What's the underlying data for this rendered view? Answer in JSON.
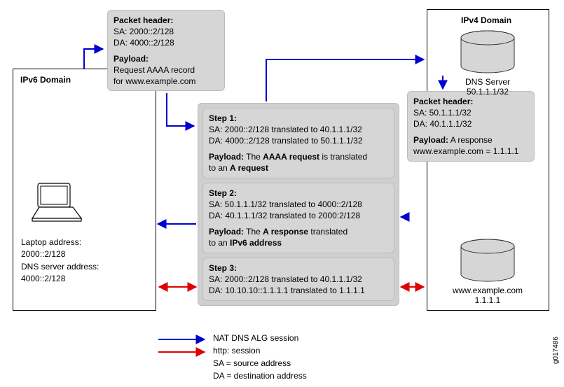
{
  "domains": {
    "ipv6_title": "IPv6 Domain",
    "ipv4_title": "IPv4 Domain"
  },
  "packet_left": {
    "hdr_label": "Packet header:",
    "sa": "SA: 2000::2/128",
    "da": "DA: 4000::2/128",
    "pl_label": "Payload:",
    "pl_line1": "Request AAAA record",
    "pl_line2": "for www.example.com"
  },
  "packet_right": {
    "hdr_label": "Packet header:",
    "sa": "SA: 50.1.1.1/32",
    "da": "DA: 40.1.1.1/32",
    "pl_label": "Payload:",
    "pl_line1": "A response",
    "pl_line2": "www.example.com = 1.1.1.1"
  },
  "step1": {
    "title": "Step 1:",
    "sa": "SA: 2000::2/128 translated to 40.1.1.1/32",
    "da": "DA: 4000::2/128 translated to 50.1.1.1/32",
    "pl_label": "Payload:",
    "pl_text_a": "The ",
    "pl_text_b": "AAAA request",
    "pl_text_c": " is translated",
    "pl_text_d": "to an ",
    "pl_text_e": "A request"
  },
  "step2": {
    "title": "Step 2:",
    "sa": "SA: 50.1.1.1/32 translated to 4000::2/128",
    "da": "DA: 40.1.1.1/32 translated to 2000:2/128",
    "pl_label": "Payload:",
    "pl_text_a": "The ",
    "pl_text_b": "A response",
    "pl_text_c": " translated",
    "pl_text_d": "to an ",
    "pl_text_e": "IPv6 address"
  },
  "step3": {
    "title": "Step 3:",
    "sa": "SA: 2000::2/128 translated to 40.1.1.1/32",
    "da": "DA: 10.10.10::1.1.1.1 translated to 1.1.1.1"
  },
  "laptop": {
    "l1": "Laptop address:",
    "l2": "2000::2/128",
    "l3": "DNS server address:",
    "l4": "4000::2/128"
  },
  "dns_server": {
    "name": "DNS Server",
    "addr": "50.1.1.1/32"
  },
  "web_server": {
    "name": "www.example.com",
    "addr": "1.1.1.1"
  },
  "legend": {
    "nat": "NAT DNS ALG session",
    "http": "http: session",
    "sa_def": "SA = source address",
    "da_def": "DA = destination address"
  },
  "tag": "g017486"
}
